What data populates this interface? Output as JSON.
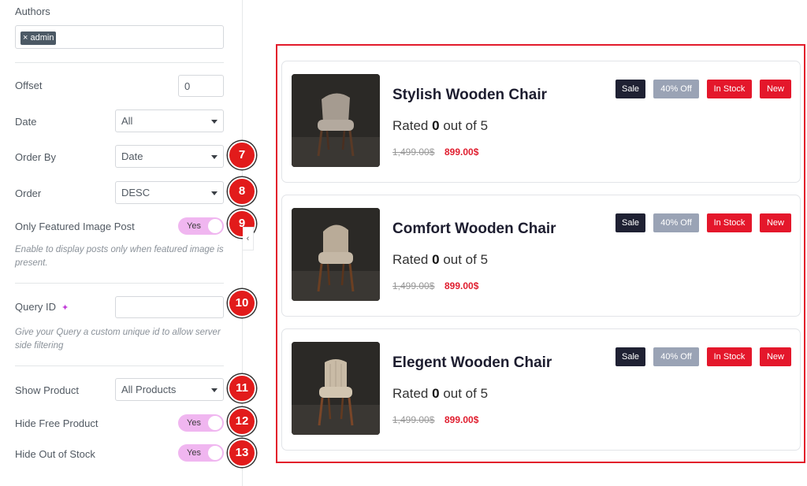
{
  "panel": {
    "authors": {
      "label": "Authors",
      "tag": "× admin"
    },
    "offset": {
      "label": "Offset",
      "value": "0"
    },
    "date": {
      "label": "Date",
      "value": "All"
    },
    "order_by": {
      "label": "Order By",
      "value": "Date",
      "badge": "7"
    },
    "order": {
      "label": "Order",
      "value": "DESC",
      "badge": "8"
    },
    "featured": {
      "label": "Only Featured Image Post",
      "toggle": "Yes",
      "badge": "9",
      "help": "Enable to display posts only when featured image is present."
    },
    "query_id": {
      "label": "Query ID",
      "value": "",
      "badge": "10",
      "help": "Give your Query a custom unique id to allow server side filtering"
    },
    "show_product": {
      "label": "Show Product",
      "value": "All Products",
      "badge": "11"
    },
    "hide_free": {
      "label": "Hide Free Product",
      "toggle": "Yes",
      "badge": "12"
    },
    "hide_out": {
      "label": "Hide Out of Stock",
      "toggle": "Yes",
      "badge": "13"
    },
    "collapse_glyph": "‹"
  },
  "products": [
    {
      "title": "Stylish Wooden Chair",
      "rated_pre": "Rated",
      "rating": "0",
      "rated_post": "out of 5",
      "old_price": "1,499.00$",
      "price": "899.00$",
      "badges": {
        "sale": "Sale",
        "off": "40% Off",
        "stock": "In Stock",
        "new": "New"
      }
    },
    {
      "title": "Comfort Wooden Chair",
      "rated_pre": "Rated",
      "rating": "0",
      "rated_post": "out of 5",
      "old_price": "1,499.00$",
      "price": "899.00$",
      "badges": {
        "sale": "Sale",
        "off": "40% Off",
        "stock": "In Stock",
        "new": "New"
      }
    },
    {
      "title": "Elegent Wooden Chair",
      "rated_pre": "Rated",
      "rating": "0",
      "rated_post": "out of 5",
      "old_price": "1,499.00$",
      "price": "899.00$",
      "badges": {
        "sale": "Sale",
        "off": "40% Off",
        "stock": "In Stock",
        "new": "New"
      }
    }
  ],
  "colors": {
    "accent": "#e21b1b",
    "toggle_on": "#f0b6f0",
    "sale": "#1f2133",
    "off": "#9aa3b5",
    "stock": "#e4172b",
    "price": "#e01e2f"
  }
}
